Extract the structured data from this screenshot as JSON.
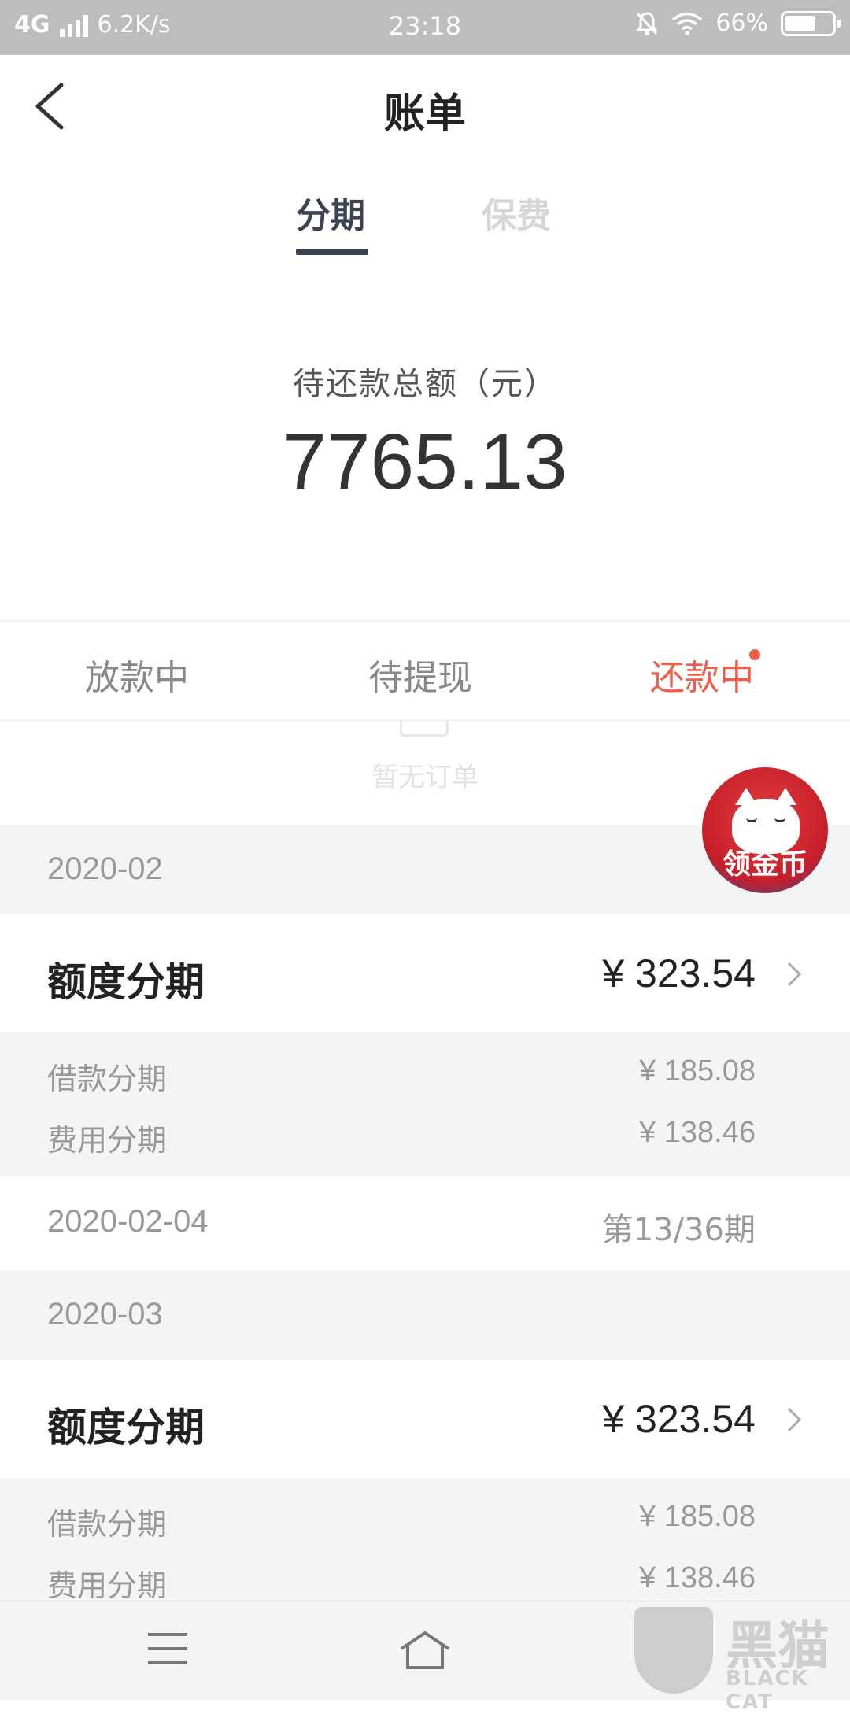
{
  "status_bar": {
    "network": "4G",
    "speed": "6.2K/s",
    "time": "23:18",
    "battery": "66%",
    "battery_level": 0.66
  },
  "header": {
    "title": "账单"
  },
  "top_tabs": [
    {
      "label": "分期",
      "active": true
    },
    {
      "label": "保费",
      "active": false
    }
  ],
  "summary": {
    "label": "待还款总额（元）",
    "amount": "7765.13"
  },
  "status_tabs": [
    {
      "label": "放款中",
      "active": false
    },
    {
      "label": "待提现",
      "active": false
    },
    {
      "label": "还款中",
      "active": true,
      "dot": true
    }
  ],
  "empty_state": {
    "text": "暂无订单"
  },
  "floating_badge": {
    "label": "领金币"
  },
  "months": [
    {
      "month": "2020-02",
      "bill_title": "额度分期",
      "amount": "¥ 323.54",
      "details": [
        {
          "label": "借款分期",
          "value": "¥ 185.08"
        },
        {
          "label": "费用分期",
          "value": "¥ 138.46"
        }
      ],
      "due_date": "2020-02-04",
      "period": "第13/36期"
    },
    {
      "month": "2020-03",
      "bill_title": "额度分期",
      "amount": "¥ 323.54",
      "details": [
        {
          "label": "借款分期",
          "value": "¥ 185.08"
        },
        {
          "label": "费用分期",
          "value": "¥ 138.46"
        }
      ]
    }
  ],
  "watermark": {
    "text": "黑猫",
    "sub": "BLACK CAT"
  },
  "colors": {
    "accent_red": "#ee5e4b",
    "tab_active": "#3b4350",
    "section_bg": "#f3f4f6"
  }
}
